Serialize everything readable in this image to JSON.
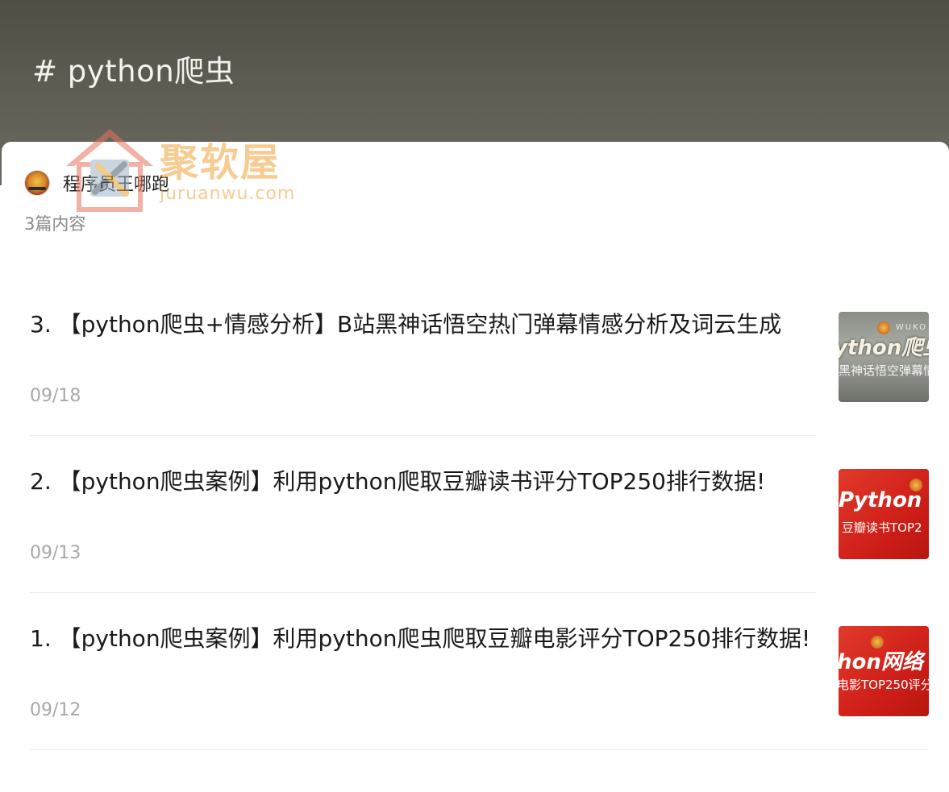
{
  "header": {
    "title": "# python爬虫"
  },
  "author": {
    "name": "程序员王哪跑",
    "avatar_icon": "avatar-icon"
  },
  "count_text": "3篇内容",
  "watermark": {
    "title": "聚软屋",
    "url": "juruanwu.com"
  },
  "articles": [
    {
      "title": "3. 【python爬虫+情感分析】B站黑神话悟空热门弹幕情感分析及词云生成",
      "date": "09/18",
      "thumb_big": "ython爬虫",
      "thumb_small": "黑神话悟空弹幕情",
      "thumb_corner": "WUKO"
    },
    {
      "title": "2. 【python爬虫案例】利用python爬取豆瓣读书评分TOP250排行数据!",
      "date": "09/13",
      "thumb_big": "Python",
      "thumb_small": "豆瓣读书TOP2"
    },
    {
      "title": "1. 【python爬虫案例】利用python爬虫爬取豆瓣电影评分TOP250排行数据!",
      "date": "09/12",
      "thumb_big": "hon网络",
      "thumb_small": "电影TOP250评分"
    }
  ]
}
